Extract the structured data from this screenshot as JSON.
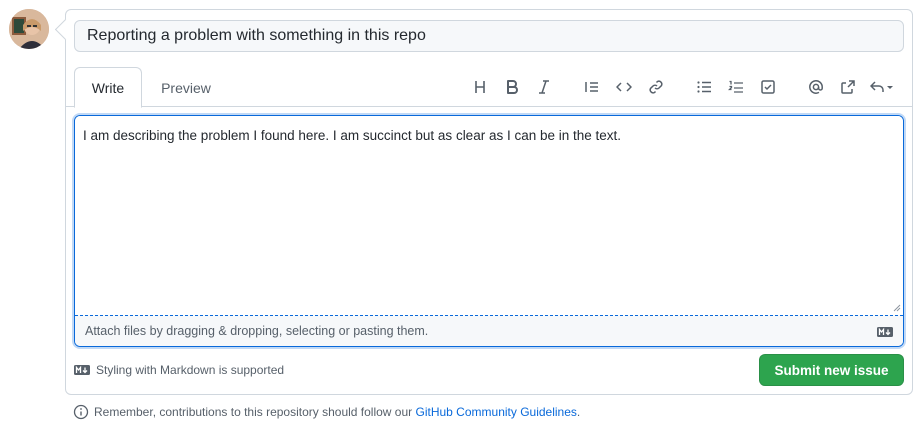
{
  "title_input": {
    "value": "Reporting a problem with something in this repo"
  },
  "tabs": [
    {
      "label": "Write"
    },
    {
      "label": "Preview"
    }
  ],
  "toolbar": {
    "icons": [
      "heading-icon",
      "bold-icon",
      "italic-icon",
      "quote-icon",
      "code-icon",
      "link-icon",
      "unordered-list-icon",
      "ordered-list-icon",
      "task-list-icon",
      "mention-icon",
      "reference-icon",
      "saved-replies-icon"
    ]
  },
  "editor": {
    "value": "I am describing the problem I found here. I am succinct but as clear as I can be in the text.",
    "attach_text": "Attach files by dragging & dropping, selecting or pasting them."
  },
  "markdown_note": "Styling with Markdown is supported",
  "submit_label": "Submit new issue",
  "footer": {
    "prefix": "Remember, contributions to this repository should follow our ",
    "link": "GitHub Community Guidelines",
    "suffix": "."
  },
  "colors": {
    "accent": "#0969da",
    "submit": "#2da44e",
    "border": "#d0d7de",
    "muted": "#57606a"
  }
}
